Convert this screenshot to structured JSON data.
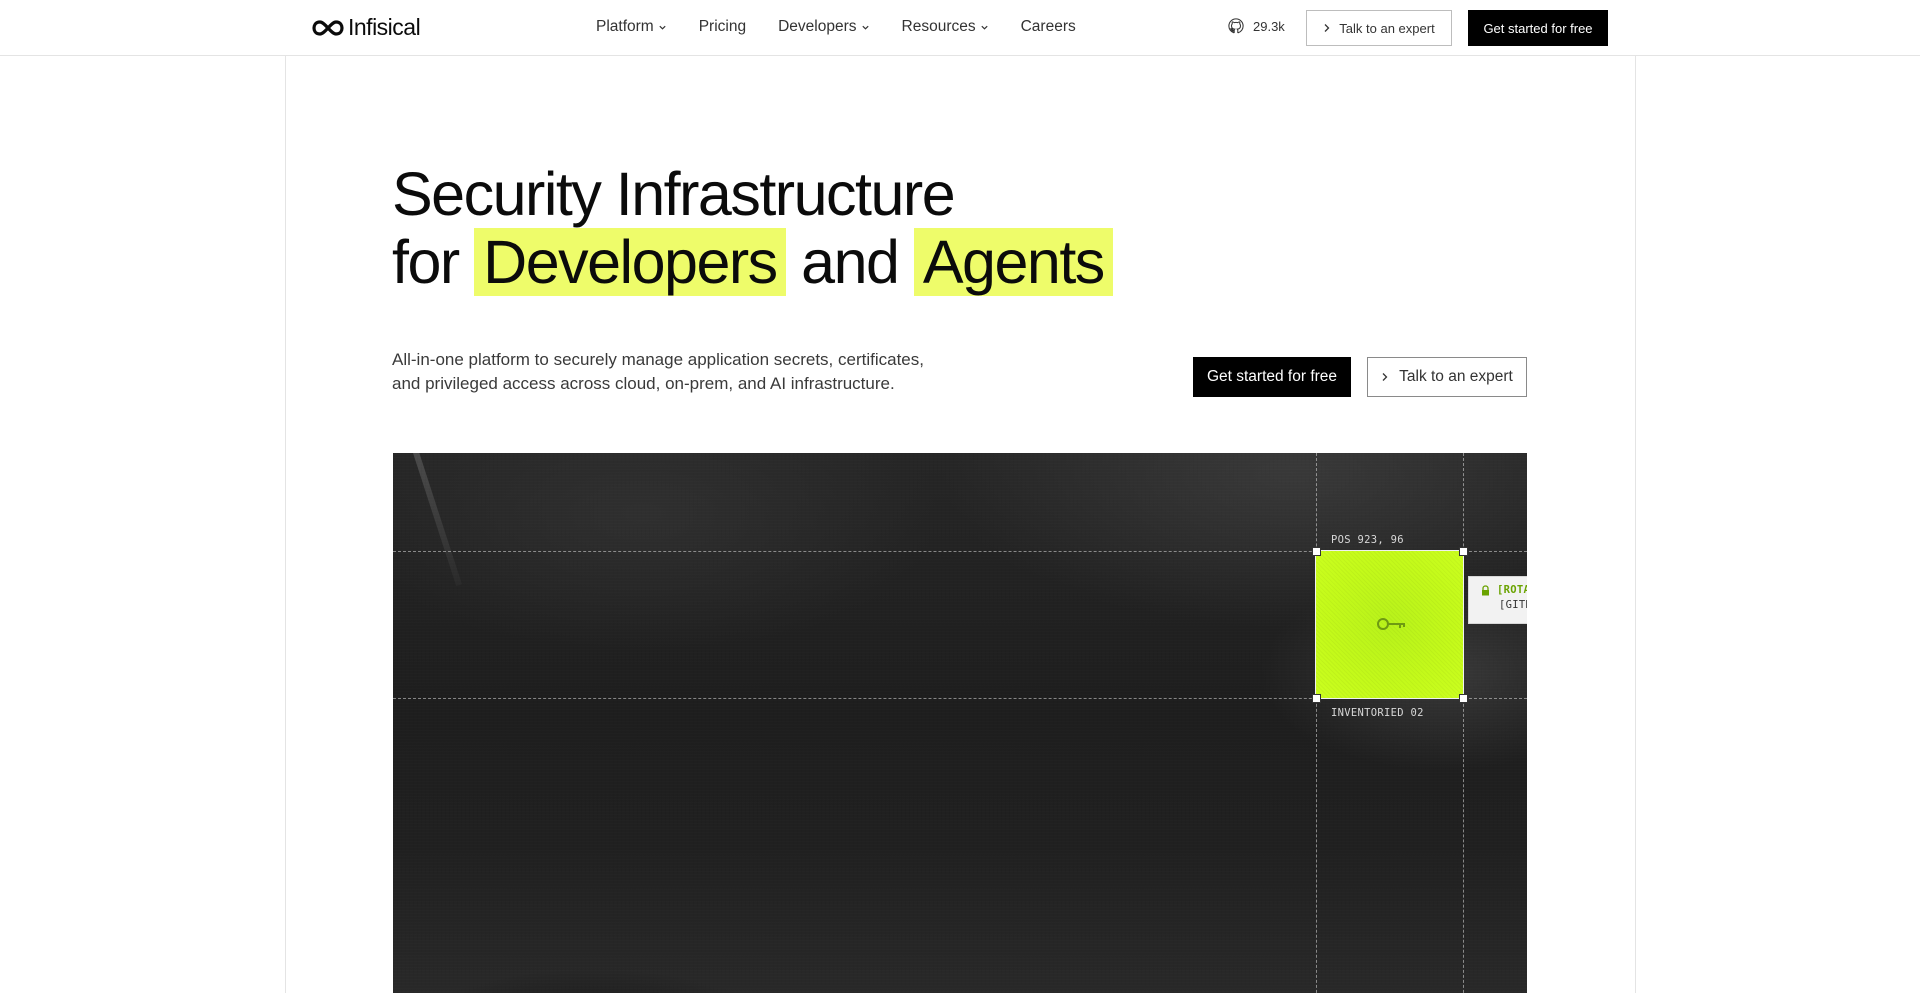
{
  "nav": {
    "brand": "Infisical",
    "links": [
      {
        "label": "Platform",
        "dropdown": true
      },
      {
        "label": "Pricing",
        "dropdown": false
      },
      {
        "label": "Developers",
        "dropdown": true
      },
      {
        "label": "Resources",
        "dropdown": true
      },
      {
        "label": "Careers",
        "dropdown": false
      }
    ],
    "github_stars": "29.3k",
    "talk_label": "Talk to an expert",
    "cta_label": "Get started for free"
  },
  "hero": {
    "line1": "Security Infrastructure",
    "line2_prefix": "for",
    "highlight1": "Developers",
    "connector": "and",
    "highlight2": "Agents",
    "subtext": "All-in-one platform to securely manage application secrets, certificates, and privileged access across cloud, on-prem, and AI infrastructure.",
    "cta_label": "Get started for free",
    "talk_label": "Talk to an expert"
  },
  "visual": {
    "pos_label": "POS 923, 96",
    "inventory_label": "INVENTORIED 02",
    "tag_title": "[ROTATING SECRST]",
    "tag_sub": "[GITHUB-DEPLOY]"
  },
  "colors": {
    "highlight": "#eefc6a",
    "accent_green": "#c4fa1a",
    "dark": "#000000"
  }
}
